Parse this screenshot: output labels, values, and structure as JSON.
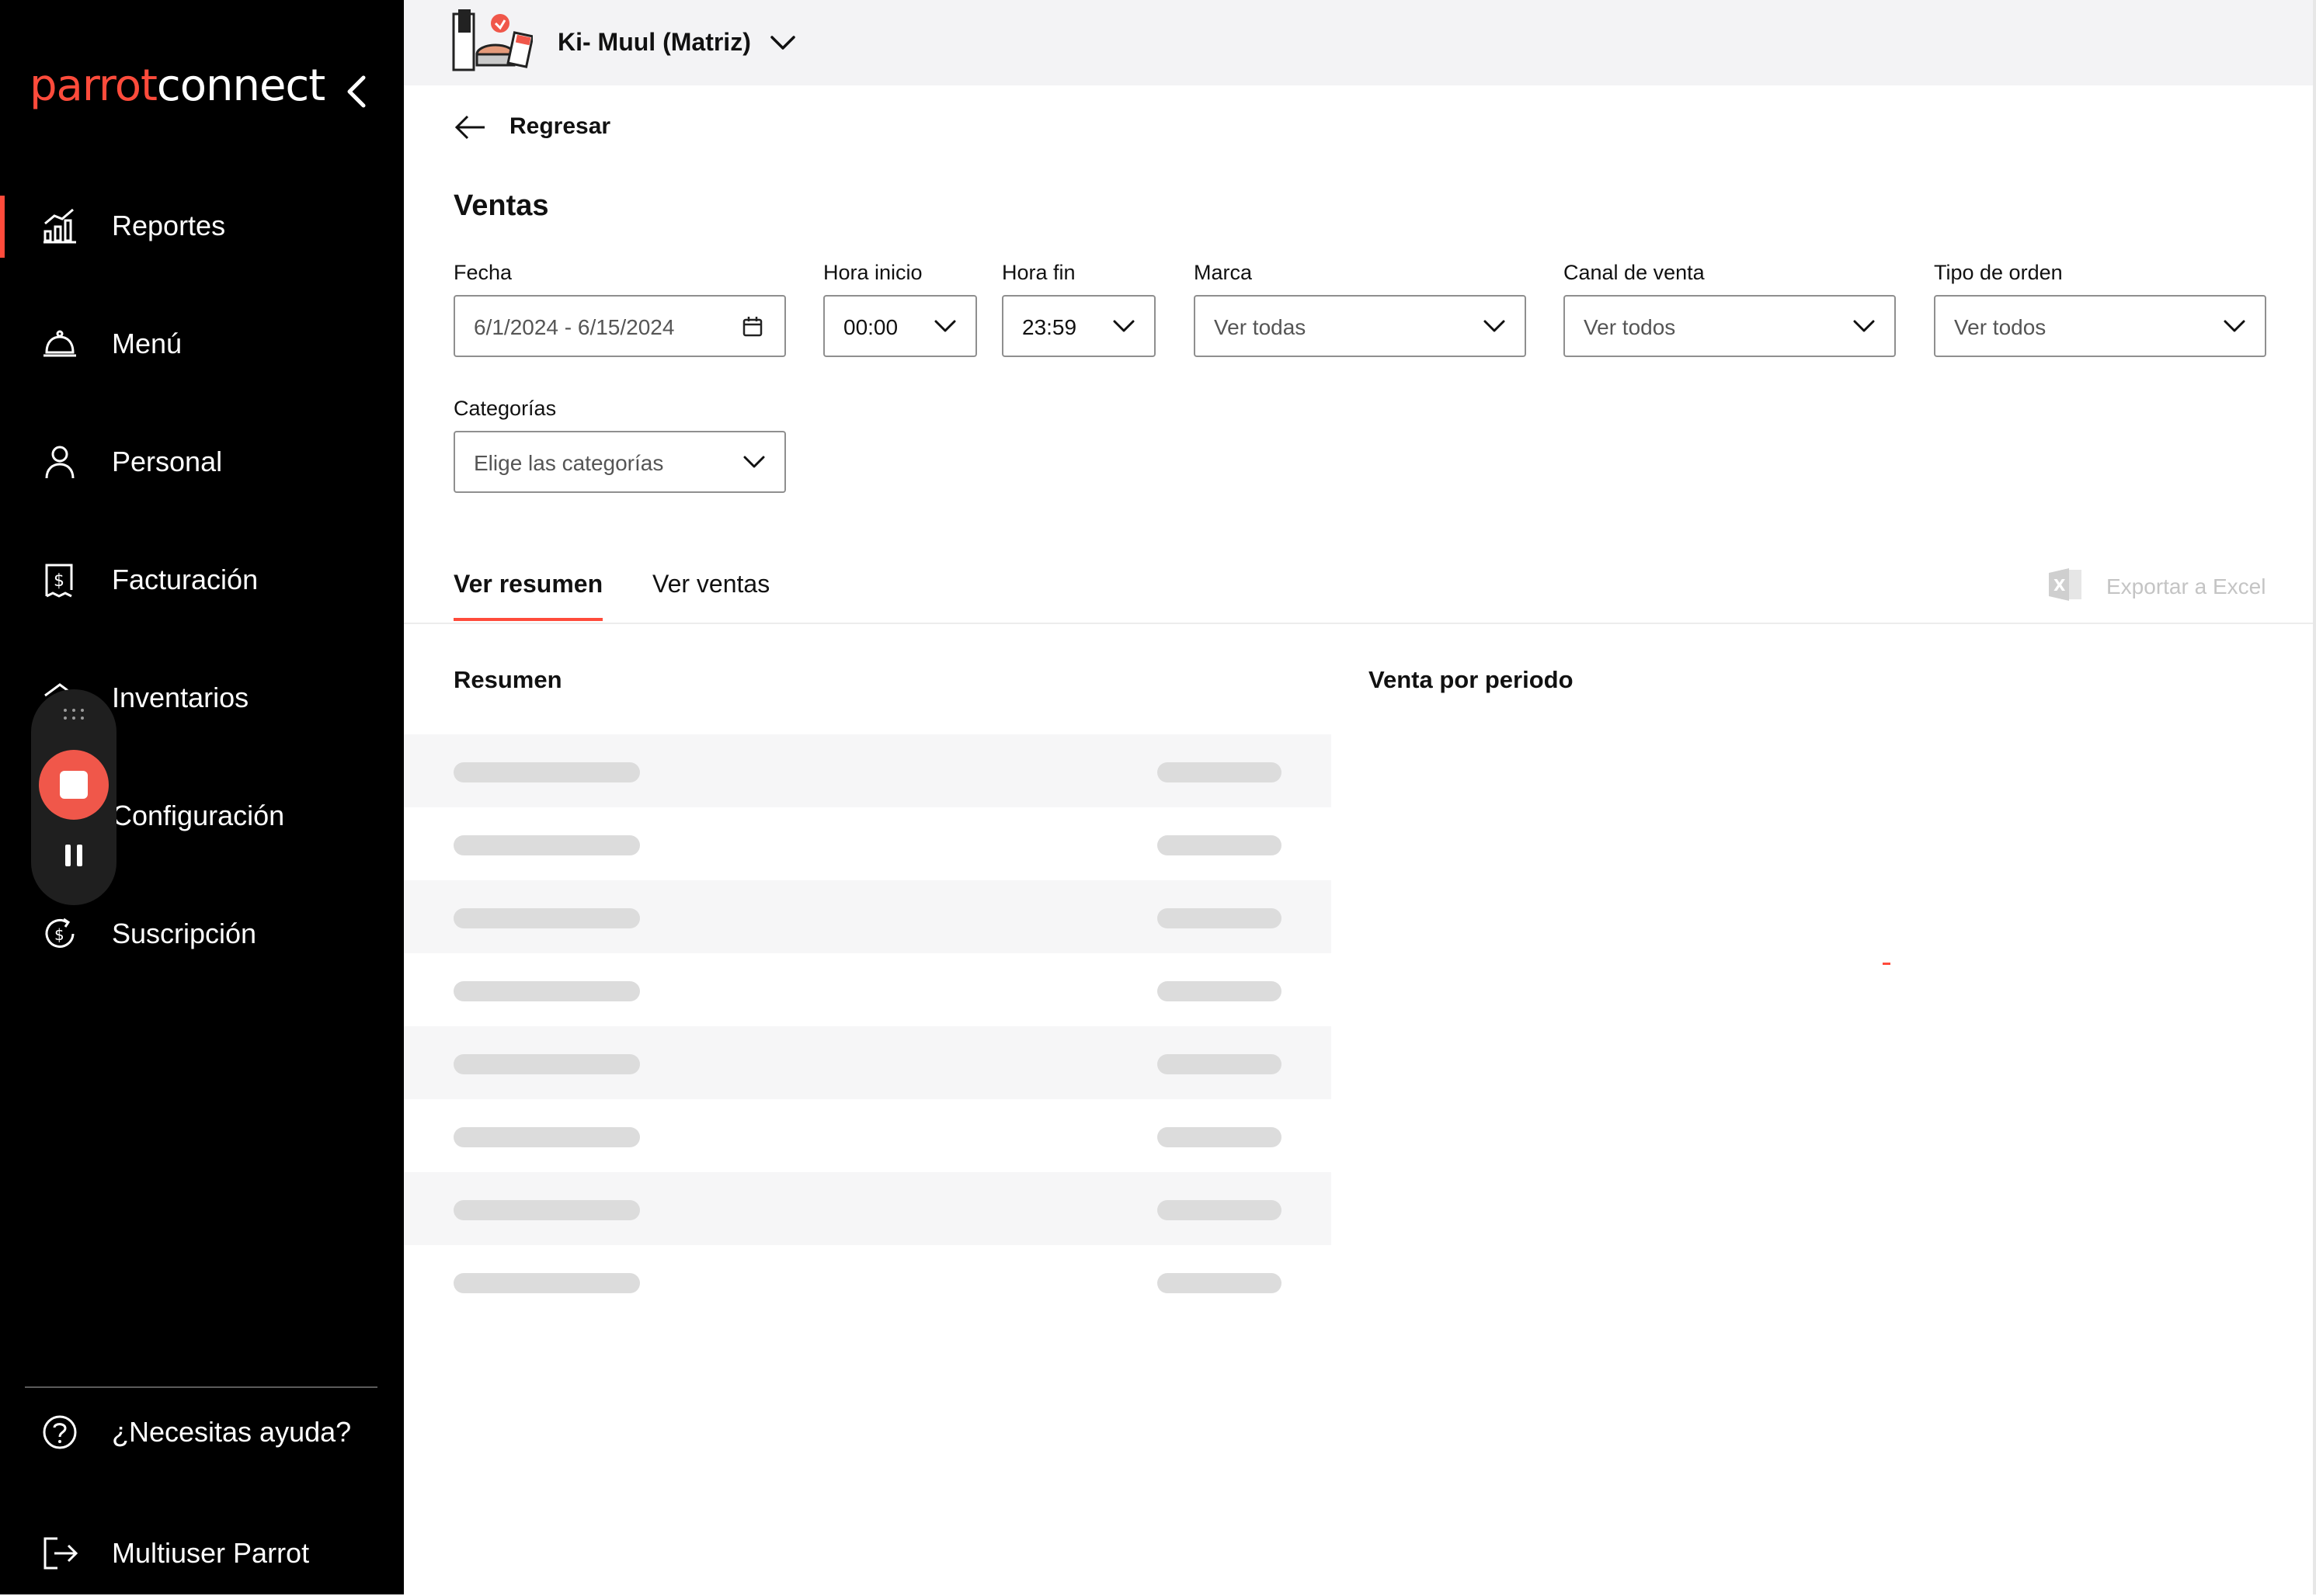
{
  "sidebar": {
    "logo": {
      "part1": "parrot",
      "part2": "connect"
    },
    "items": [
      {
        "label": "Reportes",
        "icon": "chart-bars-icon",
        "active": true
      },
      {
        "label": "Menú",
        "icon": "cloche-icon",
        "active": false
      },
      {
        "label": "Personal",
        "icon": "user-icon",
        "active": false
      },
      {
        "label": "Facturación",
        "icon": "receipt-dollar-icon",
        "active": false
      },
      {
        "label": "Inventarios",
        "icon": "inventory-icon",
        "active": false
      },
      {
        "label": "Configuración",
        "icon": "gear-icon",
        "active": false
      },
      {
        "label": "Suscripción",
        "icon": "dollar-refresh-icon",
        "active": false
      }
    ],
    "help_label": "¿Necesitas ayuda?",
    "user_label": "Multiuser Parrot"
  },
  "topbar": {
    "store_name": "Ki- Muul (Matriz)"
  },
  "back_label": "Regresar",
  "page_title": "Ventas",
  "filters": {
    "fecha": {
      "label": "Fecha",
      "value": "6/1/2024 - 6/15/2024"
    },
    "hora_inicio": {
      "label": "Hora inicio",
      "value": "00:00"
    },
    "hora_fin": {
      "label": "Hora fin",
      "value": "23:59"
    },
    "marca": {
      "label": "Marca",
      "value": "Ver todas"
    },
    "canal": {
      "label": "Canal de venta",
      "value": "Ver todos"
    },
    "tipo_orden": {
      "label": "Tipo de orden",
      "value": "Ver todos"
    },
    "categorias": {
      "label": "Categorías",
      "placeholder": "Elige las categorías"
    }
  },
  "tabs": [
    {
      "label": "Ver resumen",
      "active": true
    },
    {
      "label": "Ver ventas",
      "active": false
    }
  ],
  "export_label": "Exportar a Excel",
  "sections": {
    "resumen": "Resumen",
    "venta_periodo": "Venta por periodo"
  },
  "colors": {
    "accent": "#ff4b3b",
    "sidebar_bg": "#000000",
    "topbar_bg": "#f3f3f5",
    "skeleton": "#dcdcdc"
  }
}
